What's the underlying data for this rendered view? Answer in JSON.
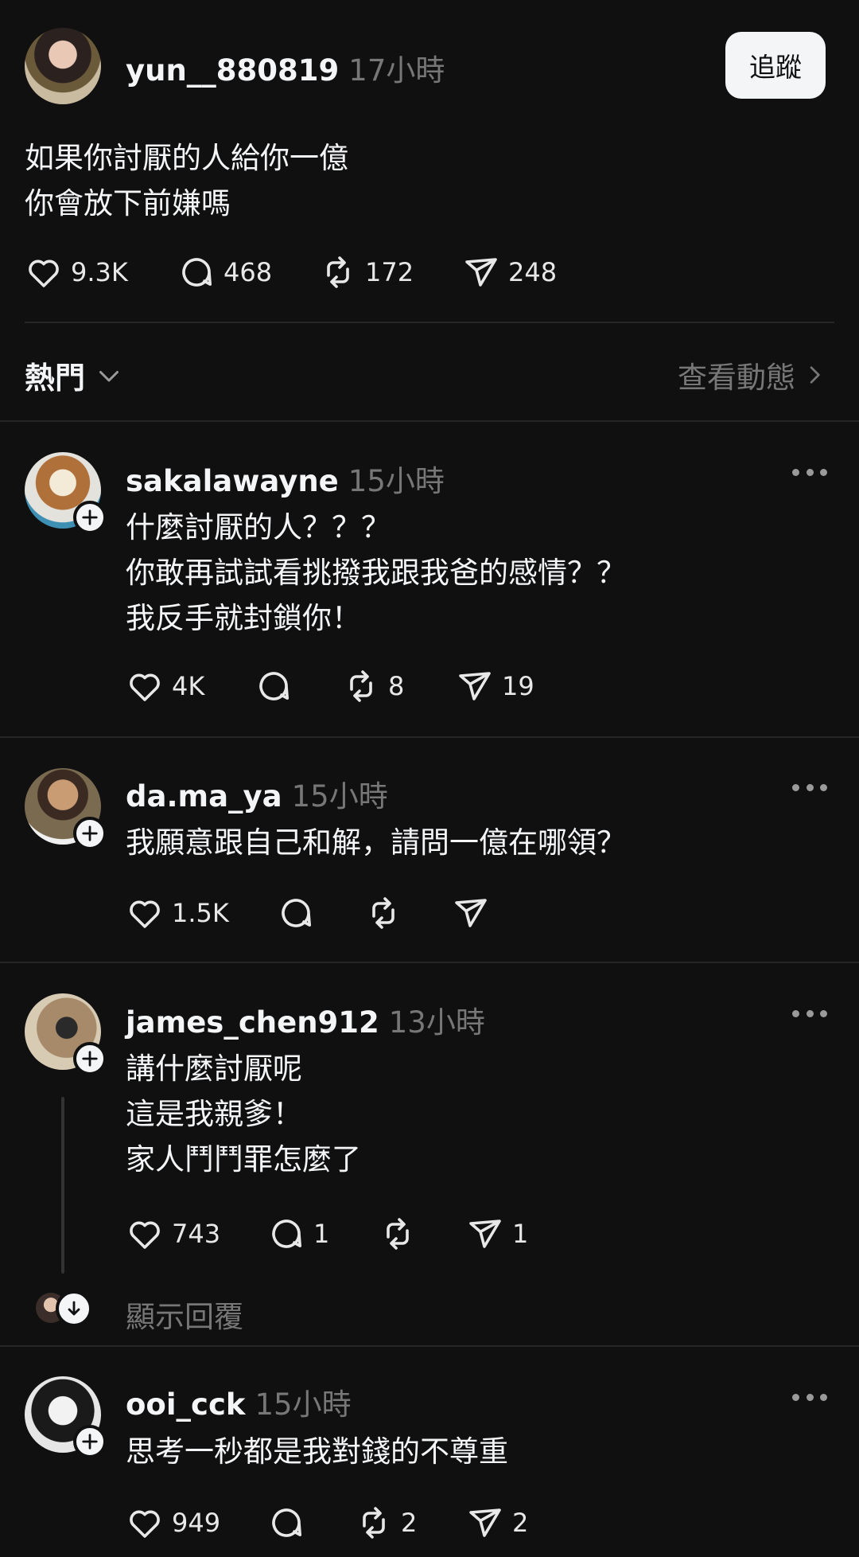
{
  "post": {
    "username": "yun__880819",
    "time": "17小時",
    "follow_label": "追蹤",
    "text": "如果你討厭的人給你一億\n你會放下前嫌嗎",
    "likes": "9.3K",
    "comments": "468",
    "reposts": "172",
    "shares": "248"
  },
  "sort": {
    "label": "熱門",
    "activity_label": "查看動態"
  },
  "replies": [
    {
      "username": "sakalawayne",
      "time": "15小時",
      "text": "什麼討厭的人？？？\n你敢再試試看挑撥我跟我爸的感情？？\n我反手就封鎖你！",
      "likes": "4K",
      "comments": "",
      "reposts": "8",
      "shares": "19"
    },
    {
      "username": "da.ma_ya",
      "time": "15小時",
      "text": "我願意跟自己和解，請問一億在哪領？",
      "likes": "1.5K",
      "comments": "",
      "reposts": "",
      "shares": ""
    },
    {
      "username": "james_chen912",
      "time": "13小時",
      "text": "講什麼討厭呢\n這是我親爹！\n家人鬥鬥罪怎麼了",
      "likes": "743",
      "comments": "1",
      "reposts": "",
      "shares": "1",
      "show_replies_label": "顯示回覆"
    },
    {
      "username": "ooi_cck",
      "time": "15小時",
      "text": "思考一秒都是我對錢的不尊重",
      "likes": "949",
      "comments": "",
      "reposts": "2",
      "shares": "2"
    }
  ],
  "icons": {
    "like": "heart-icon",
    "comment": "comment-icon",
    "repost": "repost-icon",
    "share": "share-icon",
    "more": "more-icon",
    "follow_plus": "plus-icon",
    "chevron_down": "chevron-down-icon",
    "chevron_right": "chevron-right-icon",
    "arrow_down": "arrow-down-icon"
  },
  "colors": {
    "background": "#101010",
    "text": "#f3f5f7",
    "secondary": "#777777",
    "divider": "#262626"
  }
}
